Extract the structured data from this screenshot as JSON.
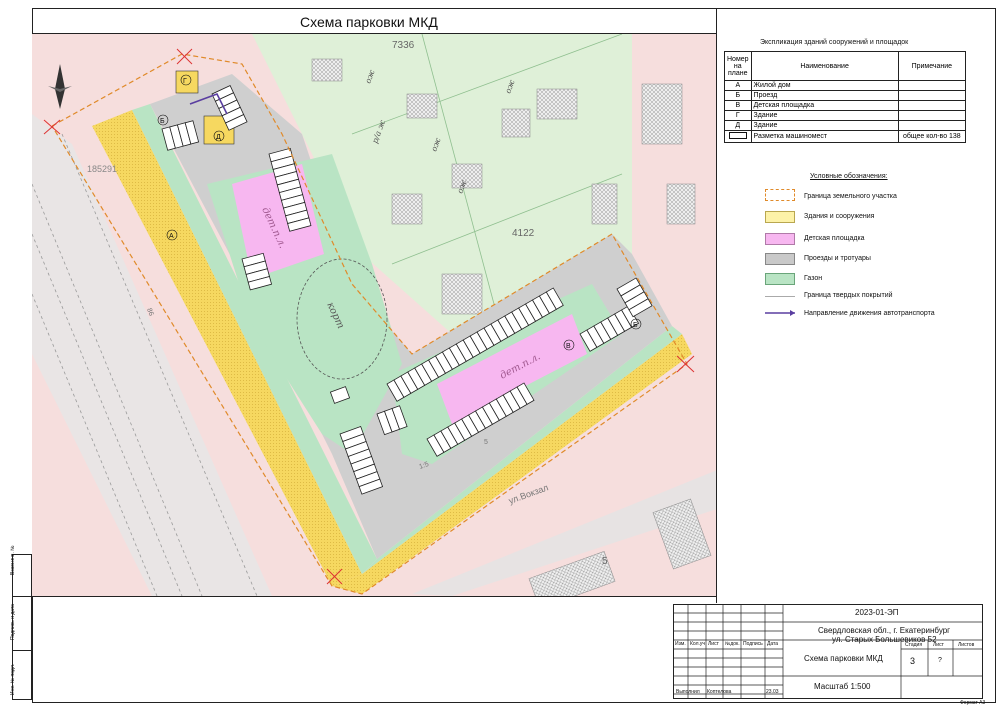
{
  "title": "Схема парковки МКД",
  "map": {
    "parcel_numbers": [
      "7336",
      "4122",
      "185291",
      "5"
    ],
    "street_label": "ул.Вокзал",
    "zone_labels": {
      "A": "А",
      "B": "Б",
      "V": "В",
      "G": "Г",
      "D": "Д",
      "B2": "Б"
    },
    "area_labels": [
      "дет.п.л.",
      "дет.п.л.",
      "корт"
    ],
    "building_marks": [
      "ож",
      "ож",
      "ож",
      "ож",
      "р/а ж"
    ],
    "small_numbers": [
      "1:5",
      "5",
      "86"
    ]
  },
  "explication": {
    "title": "Экспликация зданий сооружений и площадок",
    "headers": [
      "Номер на плане",
      "Наименование",
      "Примечание"
    ],
    "rows": [
      {
        "num": "А",
        "name": "Жилой дом",
        "note": ""
      },
      {
        "num": "Б",
        "name": "Проезд",
        "note": ""
      },
      {
        "num": "В",
        "name": "Детская площадка",
        "note": ""
      },
      {
        "num": "Г",
        "name": "Здание",
        "note": ""
      },
      {
        "num": "Д",
        "name": "Здание",
        "note": ""
      }
    ],
    "parking_row": {
      "name": "Разметка машиномест",
      "note": "общее кол-во 138"
    }
  },
  "legend": {
    "title": "Условные обозначения:",
    "items": [
      {
        "label": "Граница земельного участка",
        "swatch": "boundary"
      },
      {
        "label": "Здания и сооружения",
        "swatch": "#fdf2a8"
      },
      {
        "label": "Детская площадка",
        "swatch": "#f7b7f0"
      },
      {
        "label": "Проезды и тротуары",
        "swatch": "#c9c9c9"
      },
      {
        "label": "Газон",
        "swatch": "#b9e4c4"
      },
      {
        "label": "Граница твердых покрытий",
        "swatch": "line"
      },
      {
        "label": "Направление движения автотранспорта",
        "swatch": "arrow"
      }
    ]
  },
  "title_block": {
    "code": "2023-01-ЭП",
    "address_line1": "Свердловская обл., г. Екатеринбург",
    "address_line2": "ул. Старых Большевиков 52",
    "sheet_title": "Схема парковки МКД",
    "scale": "Масштаб 1:500",
    "col_labels": [
      "Изм.",
      "Кол.уч",
      "Лист",
      "№док.",
      "Подпись",
      "Дата"
    ],
    "stage_label": "Стадия",
    "sheet_label": "Лист",
    "sheets_label": "Листов",
    "stage_value": "3",
    "sheet_value": "?",
    "executor_role": "Выполнил",
    "executor_name": "Коптелова",
    "executor_date": "23.03",
    "format": "Формат А3"
  },
  "side_stamp": [
    "Взам.инв. №",
    "Подпись и дата",
    "Инв. № подл."
  ]
}
